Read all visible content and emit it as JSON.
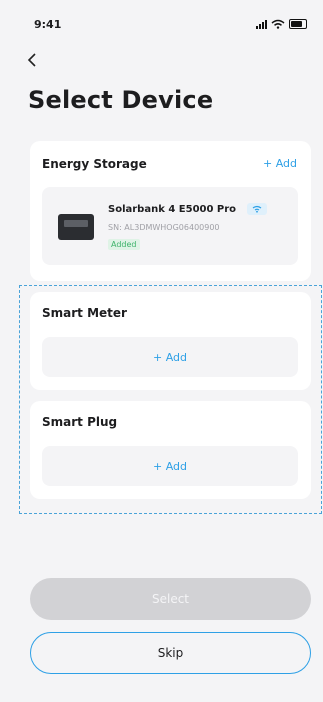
{
  "status_bar": {
    "time": "9:41"
  },
  "page": {
    "title": "Select Device"
  },
  "energy_storage": {
    "title": "Energy Storage",
    "add_label": "+ Add",
    "device": {
      "name": "Solarbank 4 E5000 Pro",
      "sn": "SN: AL3DMWHOG06400900",
      "status": "Added"
    }
  },
  "smart_meter": {
    "title": "Smart Meter",
    "add_label": "+ Add"
  },
  "smart_plug": {
    "title": "Smart Plug",
    "add_label": "+ Add"
  },
  "actions": {
    "select_label": "Select",
    "skip_label": "Skip"
  },
  "colors": {
    "accent": "#2ea0e6",
    "success": "#3fb36b",
    "disabled": "#d2d2d5"
  }
}
